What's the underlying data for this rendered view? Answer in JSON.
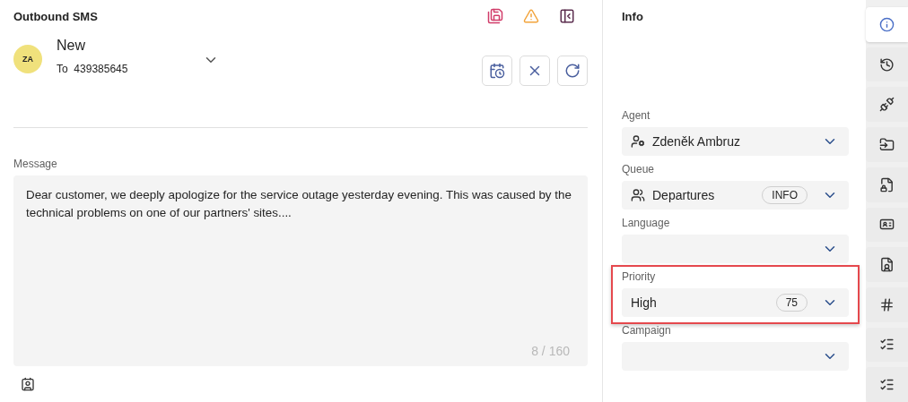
{
  "compose": {
    "title": "Outbound SMS",
    "avatar": "ZA",
    "status": "New",
    "recipient_label": "To",
    "recipient": "439385645",
    "message_label": "Message",
    "message": "Dear customer, we deeply apologize for the service outage yesterday evening. This was caused by the technical problems on one of our partners' sites....",
    "counter": "8 / 160"
  },
  "info": {
    "title": "Info",
    "fields": [
      {
        "kind": "agent",
        "label": "Agent",
        "value": "Zdeněk Ambruz",
        "highlighted": false
      },
      {
        "kind": "queue",
        "label": "Queue",
        "value": "Departures",
        "badge": "INFO",
        "highlighted": false
      },
      {
        "kind": "plain",
        "label": "Language",
        "highlighted": false
      },
      {
        "kind": "plain",
        "label": "Priority",
        "value": "High",
        "badge": "75",
        "highlighted": true
      },
      {
        "kind": "plain",
        "label": "Campaign",
        "highlighted": false
      }
    ]
  },
  "rail": [
    {
      "kind": "info",
      "selected": true
    },
    {
      "kind": "history",
      "selected": false
    },
    {
      "kind": "plug",
      "selected": false
    },
    {
      "kind": "folder",
      "selected": false
    },
    {
      "kind": "lock-file",
      "selected": false
    },
    {
      "kind": "contact-card",
      "selected": false
    },
    {
      "kind": "person-file",
      "selected": false
    },
    {
      "kind": "hash",
      "selected": false
    },
    {
      "kind": "list",
      "selected": false
    },
    {
      "kind": "list",
      "selected": false
    }
  ]
}
